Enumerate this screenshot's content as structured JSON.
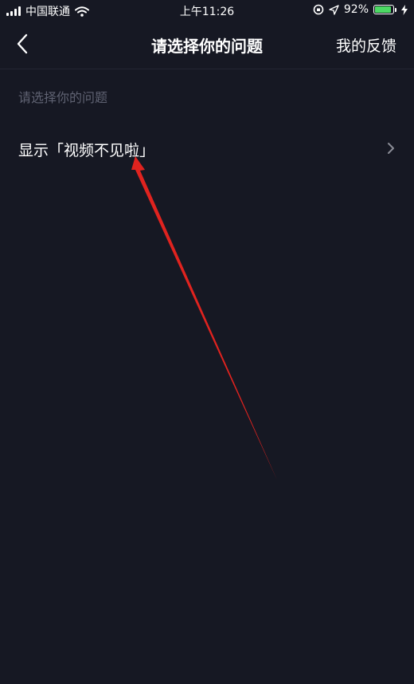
{
  "status_bar": {
    "carrier": "中国联通",
    "time": "上午11:26",
    "battery_percent": "92%",
    "battery_level": 0.92,
    "icons": [
      "signal-icon",
      "wifi-icon",
      "orientation-lock-icon",
      "location-icon",
      "battery-icon",
      "charging-icon"
    ]
  },
  "nav": {
    "back_icon": "chevron-left-icon",
    "title": "请选择你的问题",
    "action_label": "我的反馈"
  },
  "section": {
    "header": "请选择你的问题"
  },
  "items": [
    {
      "label": "显示「视频不见啦」",
      "icon": "chevron-right-icon"
    }
  ],
  "colors": {
    "background": "#161823",
    "text_primary": "#ffffff",
    "text_secondary": "#5f6272",
    "annotation_arrow": "#e0231f",
    "battery": "#4cd964"
  }
}
